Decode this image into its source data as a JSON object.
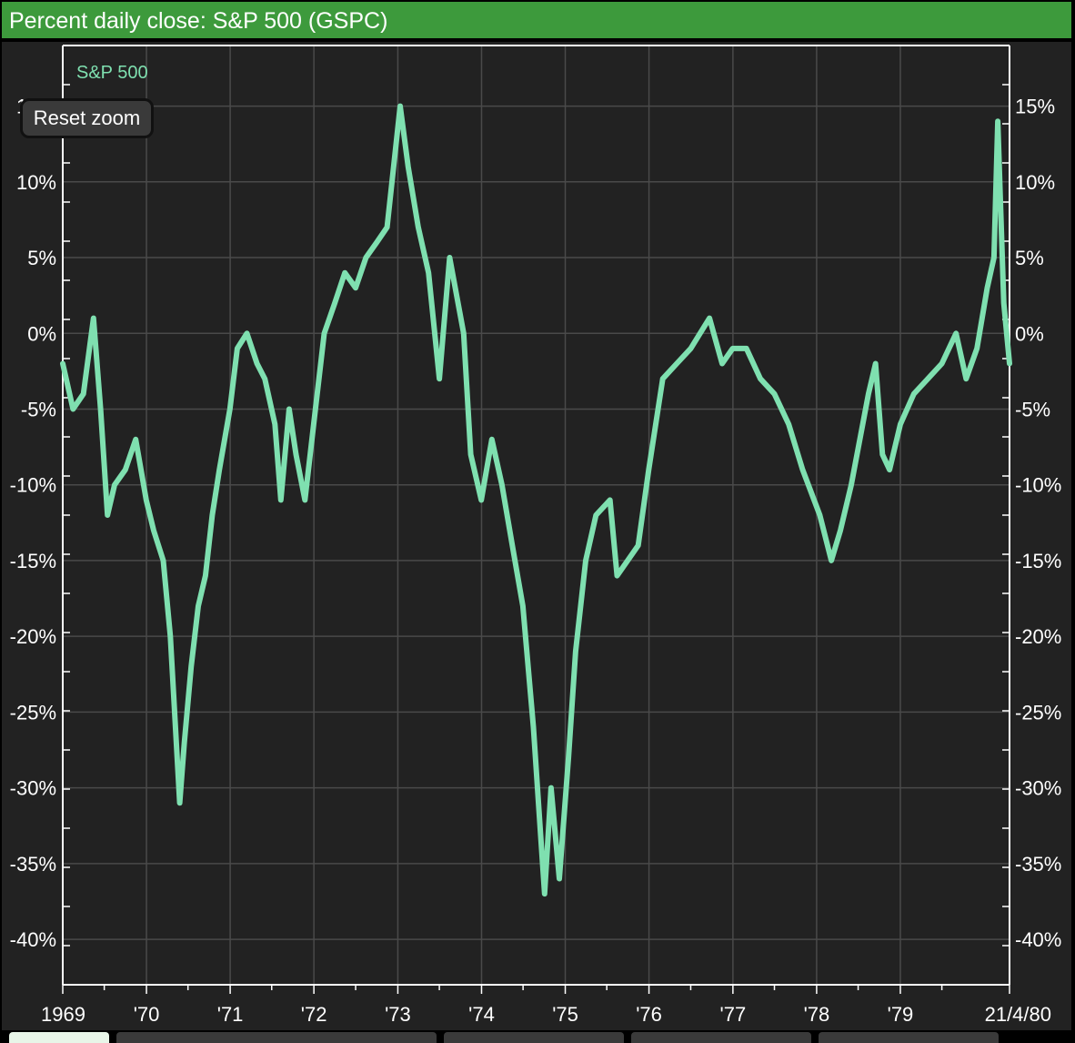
{
  "title": "Percent daily close: S&P 500 (GSPC)",
  "reset_zoom_label": "Reset zoom",
  "colors": {
    "title_bar": "#3d9a3c",
    "series": "#7fe0b0",
    "background": "#222222",
    "grid": "#4a4a4a",
    "axis": "#ffffff"
  },
  "chart_data": {
    "type": "line",
    "title": "Percent daily close: S&P 500 (GSPC)",
    "xlabel": "",
    "ylabel": "",
    "x_range": [
      "1969-01-01",
      "1980-04-21"
    ],
    "ylim": [
      -43,
      19
    ],
    "y_ticks": [
      15,
      10,
      5,
      0,
      -5,
      -10,
      -15,
      -20,
      -25,
      -30,
      -35,
      -40
    ],
    "y_tick_labels": [
      "15%",
      "10%",
      "5%",
      "0%",
      "-5%",
      "-10%",
      "-15%",
      "-20%",
      "-25%",
      "-30%",
      "-35%",
      "-40%"
    ],
    "x_ticks": [
      "1969-01-01",
      "1970-01-01",
      "1971-01-01",
      "1972-01-01",
      "1973-01-01",
      "1974-01-01",
      "1975-01-01",
      "1976-01-01",
      "1977-01-01",
      "1978-01-01",
      "1979-01-01",
      "1980-04-21"
    ],
    "x_tick_labels": [
      "1969",
      "'70",
      "'71",
      "'72",
      "'73",
      "'74",
      "'75",
      "'76",
      "'77",
      "'78",
      "'79",
      "21/4/80"
    ],
    "grid": true,
    "legend": "top-left",
    "series": [
      {
        "name": "S&P 500",
        "x": [
          "1969-01-01",
          "1969-02-15",
          "1969-04-01",
          "1969-05-15",
          "1969-06-15",
          "1969-07-15",
          "1969-08-15",
          "1969-10-01",
          "1969-11-15",
          "1969-12-31",
          "1970-02-01",
          "1970-03-15",
          "1970-04-15",
          "1970-05-26",
          "1970-06-15",
          "1970-07-15",
          "1970-08-15",
          "1970-09-15",
          "1970-10-15",
          "1970-11-15",
          "1970-12-31",
          "1971-02-01",
          "1971-03-15",
          "1971-04-28",
          "1971-06-01",
          "1971-07-15",
          "1971-08-10",
          "1971-09-15",
          "1971-10-15",
          "1971-11-23",
          "1971-12-31",
          "1972-02-15",
          "1972-04-01",
          "1972-05-15",
          "1972-07-01",
          "1972-08-15",
          "1972-10-01",
          "1972-11-15",
          "1973-01-11",
          "1973-02-15",
          "1973-03-31",
          "1973-05-15",
          "1973-07-01",
          "1973-08-15",
          "1973-10-15",
          "1973-11-15",
          "1973-12-31",
          "1974-02-15",
          "1974-03-31",
          "1974-05-15",
          "1974-06-30",
          "1974-08-15",
          "1974-09-15",
          "1974-10-03",
          "1974-10-31",
          "1974-12-06",
          "1975-01-15",
          "1975-02-15",
          "1975-03-31",
          "1975-05-15",
          "1975-07-15",
          "1975-08-15",
          "1975-09-30",
          "1975-11-15",
          "1975-12-31",
          "1976-03-01",
          "1976-05-01",
          "1976-07-01",
          "1976-09-21",
          "1976-11-15",
          "1976-12-31",
          "1977-03-01",
          "1977-05-01",
          "1977-07-01",
          "1977-09-01",
          "1977-11-01",
          "1978-01-15",
          "1978-03-06",
          "1978-04-15",
          "1978-06-01",
          "1978-08-15",
          "1978-09-15",
          "1978-10-15",
          "1978-11-15",
          "1979-01-01",
          "1979-03-01",
          "1979-05-01",
          "1979-07-01",
          "1979-09-01",
          "1979-10-15",
          "1979-12-01",
          "1980-01-15",
          "1980-02-13",
          "1980-03-01",
          "1980-03-27",
          "1980-04-21"
        ],
        "values": [
          -2,
          -5,
          -4,
          1,
          -5,
          -12,
          -10,
          -9,
          -7,
          -11,
          -13,
          -15,
          -20,
          -31,
          -27,
          -22,
          -18,
          -16,
          -12,
          -9,
          -5,
          -1,
          0,
          -2,
          -3,
          -6,
          -11,
          -5,
          -8,
          -11,
          -6,
          0,
          2,
          4,
          3,
          5,
          6,
          7,
          15,
          11,
          7,
          4,
          -3,
          5,
          0,
          -8,
          -11,
          -7,
          -10,
          -14,
          -18,
          -26,
          -33,
          -37,
          -30,
          -36,
          -28,
          -21,
          -15,
          -12,
          -11,
          -16,
          -15,
          -14,
          -9,
          -3,
          -2,
          -1,
          1,
          -2,
          -1,
          -1,
          -3,
          -4,
          -6,
          -9,
          -12,
          -15,
          -13,
          -10,
          -4,
          -2,
          -8,
          -9,
          -6,
          -4,
          -3,
          -2,
          0,
          -3,
          -1,
          3,
          5,
          14,
          2,
          -2
        ]
      }
    ]
  }
}
